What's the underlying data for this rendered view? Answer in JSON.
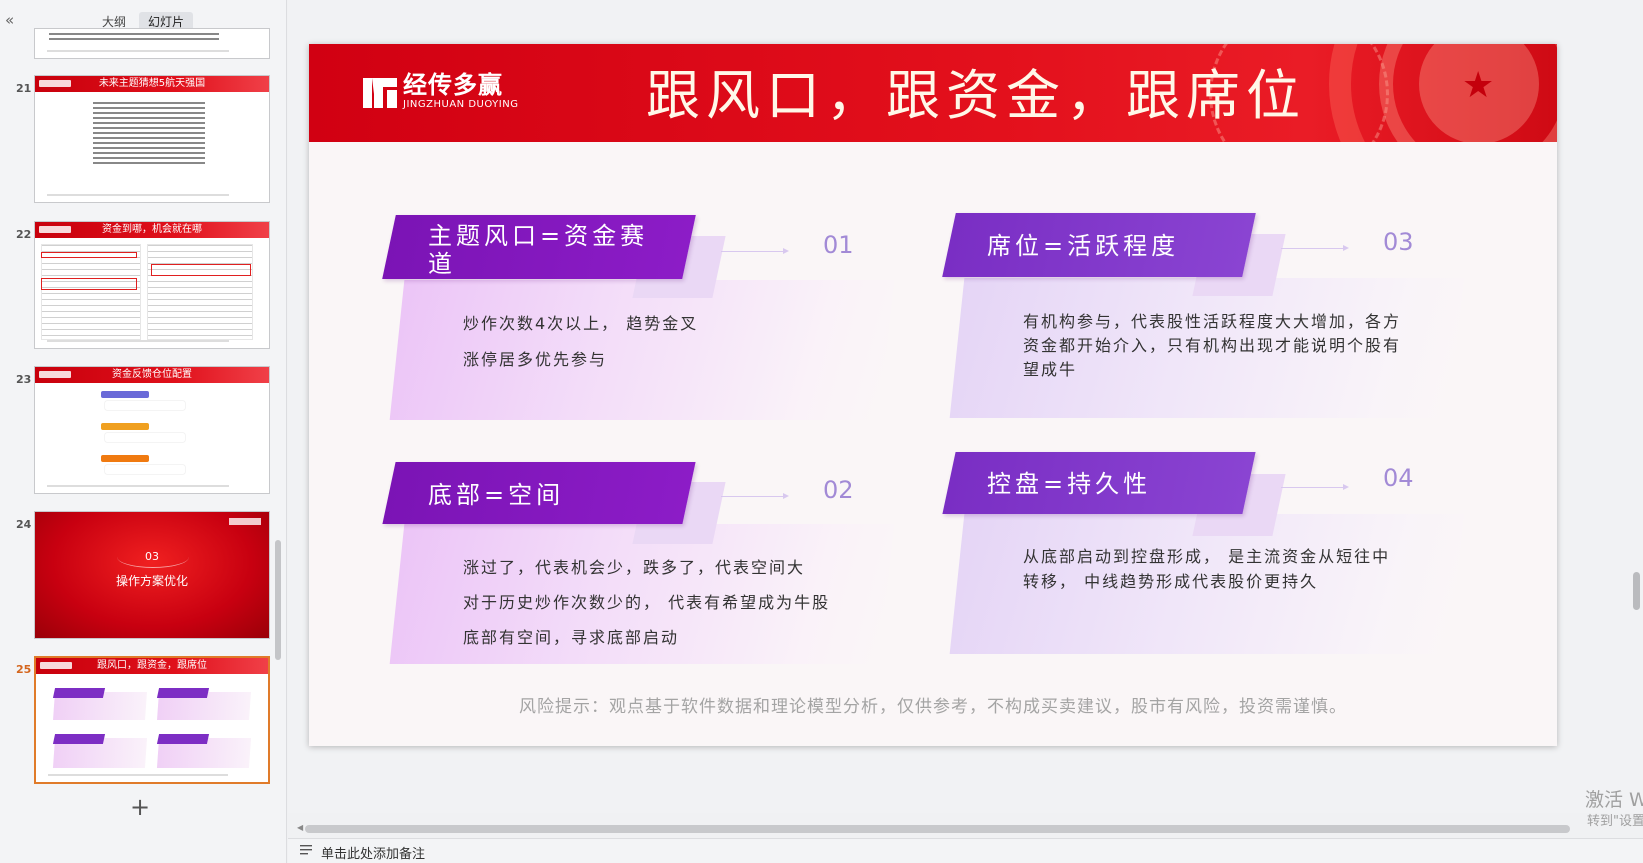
{
  "panel": {
    "tabs": [
      "大纲",
      "幻灯片"
    ],
    "collapse_icon": "«",
    "add_icon": "+"
  },
  "thumbnails": [
    {
      "num": "21",
      "title": "未来主题猜想5航天强国"
    },
    {
      "num": "22",
      "title": "资金到哪，机会就在哪"
    },
    {
      "num": "23",
      "title": "资金反馈仓位配置"
    },
    {
      "num": "24",
      "section_num": "03",
      "title": "操作方案优化"
    },
    {
      "num": "25",
      "title": "跟风口，跟资金，跟席位"
    }
  ],
  "slide": {
    "logo": {
      "cn": "经传多赢",
      "en": "JINGZHUAN DUOYING"
    },
    "title": "跟风口，跟资金，跟席位",
    "sections": [
      {
        "num": "01",
        "heading_line1": "主题风口=资金赛",
        "heading_line2": "道",
        "lines": [
          "炒作次数4次以上，  趋势金叉",
          "涨停居多优先参与"
        ]
      },
      {
        "num": "02",
        "heading": "底部=空间",
        "lines": [
          "涨过了，代表机会少，跌多了，代表空间大",
          "对于历史炒作次数少的，  代表有希望成为牛股",
          "底部有空间，寻求底部启动"
        ]
      },
      {
        "num": "03",
        "heading": "席位=活跃程度",
        "lines": [
          "有机构参与，代表股性活跃程度大大增加，各方",
          "资金都开始介入，只有机构出现才能说明个股有",
          "望成牛"
        ]
      },
      {
        "num": "04",
        "heading": "控盘=持久性",
        "lines": [
          "从底部启动到控盘形成，  是主流资金从短往中",
          "转移，  中线趋势形成代表股价更持久"
        ]
      }
    ],
    "risk_note": "风险提示：观点基于软件数据和理论模型分析，仅供参考，不构成买卖建议，股市有风险，投资需谨慎。"
  },
  "watermark": {
    "line1": "激活 W",
    "line2": "转到\"设置"
  },
  "notes": {
    "placeholder": "单击此处添加备注"
  },
  "colors": {
    "header_red": "#e3101c",
    "tag_purple": "#8c1cc7",
    "active_thumb_border": "#e07b2a",
    "number_purple": "#a28ad6"
  }
}
